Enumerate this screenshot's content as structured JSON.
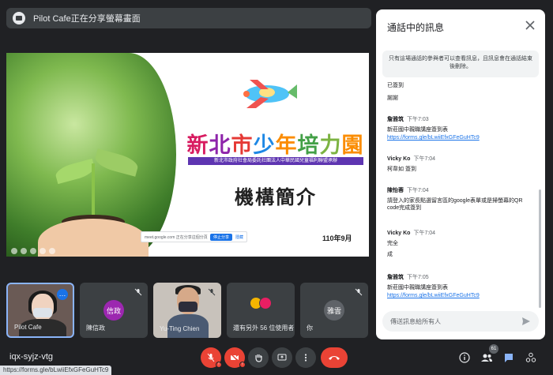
{
  "banner": {
    "text": "Pilot Cafe正在分享螢幕畫面"
  },
  "slide": {
    "brand_chars": [
      "新",
      "北",
      "市",
      "少",
      "年",
      "培",
      "力",
      "園"
    ],
    "org_line": "新北市政府社會局委託社團法人中華民國兒童福利聯盟承辦",
    "heading": "機構簡介",
    "date": "110年9月",
    "share_notice": "meet.google.com 正在分享這個分頁。",
    "share_stop": "停止分享",
    "share_hide": "隱藏"
  },
  "tiles": [
    {
      "name": "Pilot Cafe"
    },
    {
      "name": "陳信政",
      "initials": "信政",
      "color": "#9c27b0"
    },
    {
      "name": "Yu-Ting Chien"
    },
    {
      "name": "還有另外 56 位使用者",
      "colors": [
        "#f4b400",
        "#e91e63"
      ]
    },
    {
      "name": "你",
      "initials": "雅雲",
      "color": "#5f6368"
    }
  ],
  "bottom": {
    "meeting_code": "iqx-syjz-vtg",
    "people_count": "61",
    "status_url": "https://forms.gle/bLwiiEfxGFeGuHTc9"
  },
  "chat": {
    "title": "通話中的訊息",
    "notice": "只有這場通話的參與者可以查看訊息，且訊息會在通話結束後刪除。",
    "messages": [
      {
        "sender": "",
        "time": "",
        "lines": [
          "已簽到"
        ],
        "link": ""
      },
      {
        "sender": "",
        "time": "",
        "lines": [
          "謝謝"
        ],
        "link": ""
      },
      {
        "sender": "詹雅筑",
        "time": "下午7:03",
        "lines": [
          "新莊國中親職講座簽到表"
        ],
        "link": "https://forms.gle/bLwiiEfxGFeGuHTc9"
      },
      {
        "sender": "Vicky Ko",
        "time": "下午7:04",
        "lines": [
          "柯韋如 簽到"
        ],
        "link": ""
      },
      {
        "sender": "陳怡蓉",
        "time": "下午7:04",
        "lines": [
          "請登入的家長點選留言區的google表單或是掃螢幕的QR code完成簽到"
        ],
        "link": ""
      },
      {
        "sender": "Vicky Ko",
        "time": "下午7:04",
        "lines": [
          "完全"
        ],
        "link": ""
      },
      {
        "sender": "",
        "time": "",
        "lines": [
          "成"
        ],
        "link": ""
      },
      {
        "sender": "詹雅筑",
        "time": "下午7:05",
        "lines": [
          "新莊國中親職講座簽到表"
        ],
        "link": "https://forms.gle/bLwiiEfxGFeGuHTc9"
      }
    ],
    "input_placeholder": "傳送訊息給所有人"
  }
}
